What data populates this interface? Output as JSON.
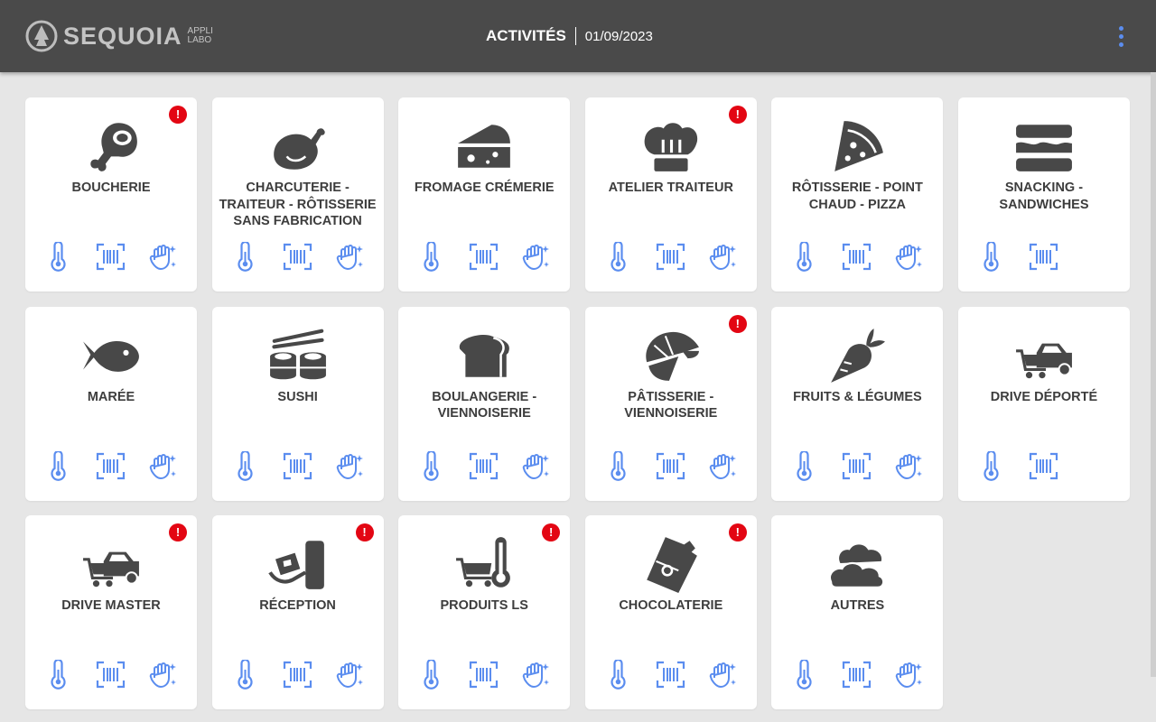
{
  "header": {
    "logo_name": "SEQUOIA",
    "logo_sub1": "APPLI",
    "logo_sub2": "LABO",
    "title": "ACTIVITÉS",
    "date": "01/09/2023",
    "menu_icon": "more-vert-icon"
  },
  "colors": {
    "header_bg": "#4a4a4a",
    "accent": "#5b8def",
    "alert": "#e30613",
    "icon": "#484848"
  },
  "cards": [
    {
      "label": "BOUCHERIE",
      "icon": "meat-icon",
      "alert": "!",
      "actions": [
        "thermometer-icon",
        "barcode-icon",
        "cleaning-hand-icon"
      ]
    },
    {
      "label": "CHARCUTERIE - TRAITEUR - RÔTISSERIE SANS FABRICATION",
      "icon": "roast-chicken-icon",
      "alert": "",
      "actions": [
        "thermometer-icon",
        "barcode-icon",
        "cleaning-hand-icon"
      ]
    },
    {
      "label": "FROMAGE CRÉMERIE",
      "icon": "cheese-icon",
      "alert": "",
      "actions": [
        "thermometer-icon",
        "barcode-icon",
        "cleaning-hand-icon"
      ]
    },
    {
      "label": "ATELIER TRAITEUR",
      "icon": "chef-hat-icon",
      "alert": "!",
      "actions": [
        "thermometer-icon",
        "barcode-icon",
        "cleaning-hand-icon"
      ]
    },
    {
      "label": "RÔTISSERIE - POINT CHAUD - PIZZA",
      "icon": "pizza-slice-icon",
      "alert": "",
      "actions": [
        "thermometer-icon",
        "barcode-icon",
        "cleaning-hand-icon"
      ]
    },
    {
      "label": "SNACKING - SANDWICHES",
      "icon": "sandwich-icon",
      "alert": "",
      "actions": [
        "thermometer-icon",
        "barcode-icon"
      ]
    },
    {
      "label": "MARÉE",
      "icon": "fish-icon",
      "alert": "",
      "actions": [
        "thermometer-icon",
        "barcode-icon",
        "cleaning-hand-icon"
      ]
    },
    {
      "label": "SUSHI",
      "icon": "sushi-icon",
      "alert": "",
      "actions": [
        "thermometer-icon",
        "barcode-icon",
        "cleaning-hand-icon"
      ]
    },
    {
      "label": "BOULANGERIE - VIENNOISERIE",
      "icon": "bread-icon",
      "alert": "",
      "actions": [
        "thermometer-icon",
        "barcode-icon",
        "cleaning-hand-icon"
      ]
    },
    {
      "label": "PÂTISSERIE - VIENNOISERIE",
      "icon": "croissant-icon",
      "alert": "!",
      "actions": [
        "thermometer-icon",
        "barcode-icon",
        "cleaning-hand-icon"
      ]
    },
    {
      "label": "FRUITS & LÉGUMES",
      "icon": "carrot-icon",
      "alert": "",
      "actions": [
        "thermometer-icon",
        "barcode-icon",
        "cleaning-hand-icon"
      ]
    },
    {
      "label": "DRIVE DÉPORTÉ",
      "icon": "cart-car-icon",
      "alert": "",
      "actions": [
        "thermometer-icon",
        "barcode-icon"
      ]
    },
    {
      "label": "DRIVE MASTER",
      "icon": "cart-car-icon",
      "alert": "!",
      "actions": [
        "thermometer-icon",
        "barcode-icon",
        "cleaning-hand-icon"
      ]
    },
    {
      "label": "RÉCEPTION",
      "icon": "dolly-box-icon",
      "alert": "!",
      "actions": [
        "thermometer-icon",
        "barcode-icon",
        "cleaning-hand-icon"
      ]
    },
    {
      "label": "PRODUITS LS",
      "icon": "cart-thermometer-icon",
      "alert": "!",
      "actions": [
        "thermometer-icon",
        "barcode-icon",
        "cleaning-hand-icon"
      ]
    },
    {
      "label": "CHOCOLATERIE",
      "icon": "chocolate-bar-icon",
      "alert": "!",
      "actions": [
        "thermometer-icon",
        "barcode-icon",
        "cleaning-hand-icon"
      ]
    },
    {
      "label": "AUTRES",
      "icon": "clouds-icon",
      "alert": "",
      "actions": [
        "thermometer-icon",
        "barcode-icon",
        "cleaning-hand-icon"
      ]
    }
  ]
}
